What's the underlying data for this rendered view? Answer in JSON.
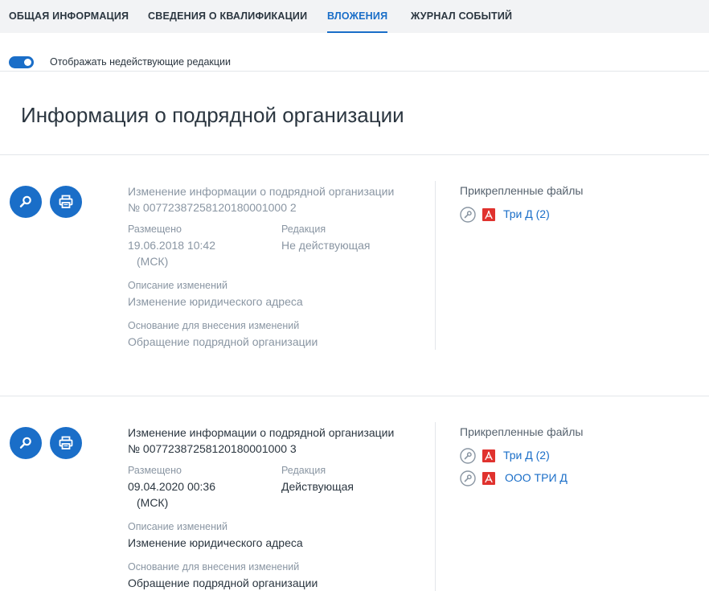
{
  "tabs": [
    {
      "label": "ОБЩАЯ ИНФОРМАЦИЯ",
      "active": false
    },
    {
      "label": "СВЕДЕНИЯ О КВАЛИФИКАЦИИ",
      "active": false
    },
    {
      "label": "ВЛОЖЕНИЯ",
      "active": true
    },
    {
      "label": "ЖУРНАЛ СОБЫТИЙ",
      "active": false
    }
  ],
  "toggle": {
    "label": "Отображать недействующие редакции",
    "on": true
  },
  "page_title": "Информация о подрядной организации",
  "labels": {
    "placed": "Размещено",
    "edition": "Редакция",
    "changes_desc": "Описание изменений",
    "basis": "Основание для внесения изменений",
    "attached_files": "Прикрепленные файлы"
  },
  "records": [
    {
      "title_line1": "Изменение информации о подрядной организации",
      "title_line2": "№ 00772387258120180001000 2",
      "placed_date": "19.06.2018 10:42",
      "placed_tz": "(МСК)",
      "edition": "Не действующая",
      "changes_desc": "Изменение юридического адреса",
      "basis": "Обращение подрядной организации",
      "files": [
        {
          "name": "Три Д (2)"
        }
      ]
    },
    {
      "title_line1": "Изменение информации о подрядной организации",
      "title_line2": "№ 00772387258120180001000 3",
      "placed_date": "09.04.2020 00:36",
      "placed_tz": "(МСК)",
      "edition": "Действующая",
      "changes_desc": "Изменение юридического адреса",
      "basis": "Обращение подрядной организации",
      "files": [
        {
          "name": "Три Д (2)"
        },
        {
          "name": "ООО ТРИ Д"
        }
      ]
    }
  ],
  "colors": {
    "accent": "#1a6ec8",
    "muted": "#8a96a3",
    "text": "#2b3640",
    "pdf": "#e0322e"
  },
  "icons": {
    "view": "magnifier-icon",
    "print": "printer-icon",
    "signature": "key-icon",
    "file": "pdf-icon"
  }
}
